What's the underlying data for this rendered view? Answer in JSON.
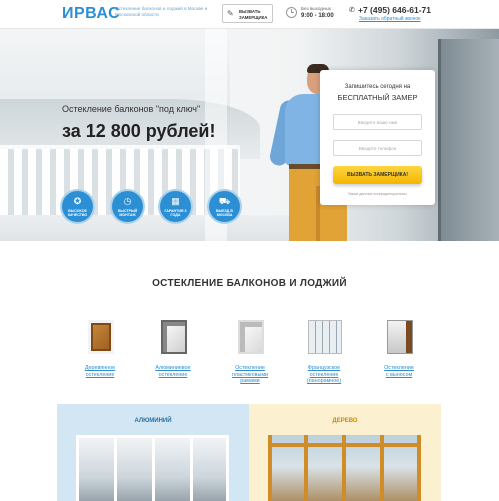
{
  "header": {
    "logo": "ИРВАС",
    "tagline": "Остекление балконов и лоджий в Москве и Московской области",
    "call_button": "ВЫЗВАТЬ ЗАМЕРЩИКА",
    "hours_label": "Без выходных",
    "hours_value": "9:00 - 18:00",
    "phone": "+7 (495) 646-61-71",
    "callback_link": "Заказать обратный звонок"
  },
  "hero": {
    "subtitle": "Остекление балконов \"под ключ\"",
    "price": "за 12 800 рублей!",
    "features": [
      {
        "icon": "medal-icon",
        "label": "ВЫСОКОЕ КАЧЕСТВО"
      },
      {
        "icon": "timer-icon",
        "label": "БЫСТРЫЙ МОНТАЖ"
      },
      {
        "icon": "calendar-icon",
        "label": "ГАРАНТИЯ 3 ГОДА"
      },
      {
        "icon": "car-icon",
        "label": "ВЫЕЗД В МОСКВА"
      }
    ]
  },
  "form": {
    "title_line1": "Запишитесь сегодня на",
    "title_line2": "БЕСПЛАТНЫЙ ЗАМЕР",
    "name_placeholder": "Введите ваше имя",
    "phone_placeholder": "Введите телефон",
    "submit": "ВЫЗВАТЬ ЗАМЕРЩИКА!",
    "note": "Ваши данные конфиденциальны"
  },
  "section": {
    "title": "ОСТЕКЛЕНИЕ БАЛКОНОВ И ЛОДЖИЙ",
    "types": [
      {
        "line1": "Деревянное",
        "line2": "остекление",
        "line3": ""
      },
      {
        "line1": "Алюминиевое",
        "line2": "остекление",
        "line3": ""
      },
      {
        "line1": "Остекление",
        "line2": "пластиковыми",
        "line3": "рамами"
      },
      {
        "line1": "Французское",
        "line2": "остекление",
        "line3": "(панорамное)"
      },
      {
        "line1": "Остекление",
        "line2": "с выносом",
        "line3": ""
      }
    ]
  },
  "panels": {
    "left_title": "АЛЮМИНИЙ",
    "right_title": "ДЕРЕВО"
  },
  "colors": {
    "accent": "#2d8fd3",
    "button": "#f2b600",
    "wood_title": "#c88a00"
  }
}
